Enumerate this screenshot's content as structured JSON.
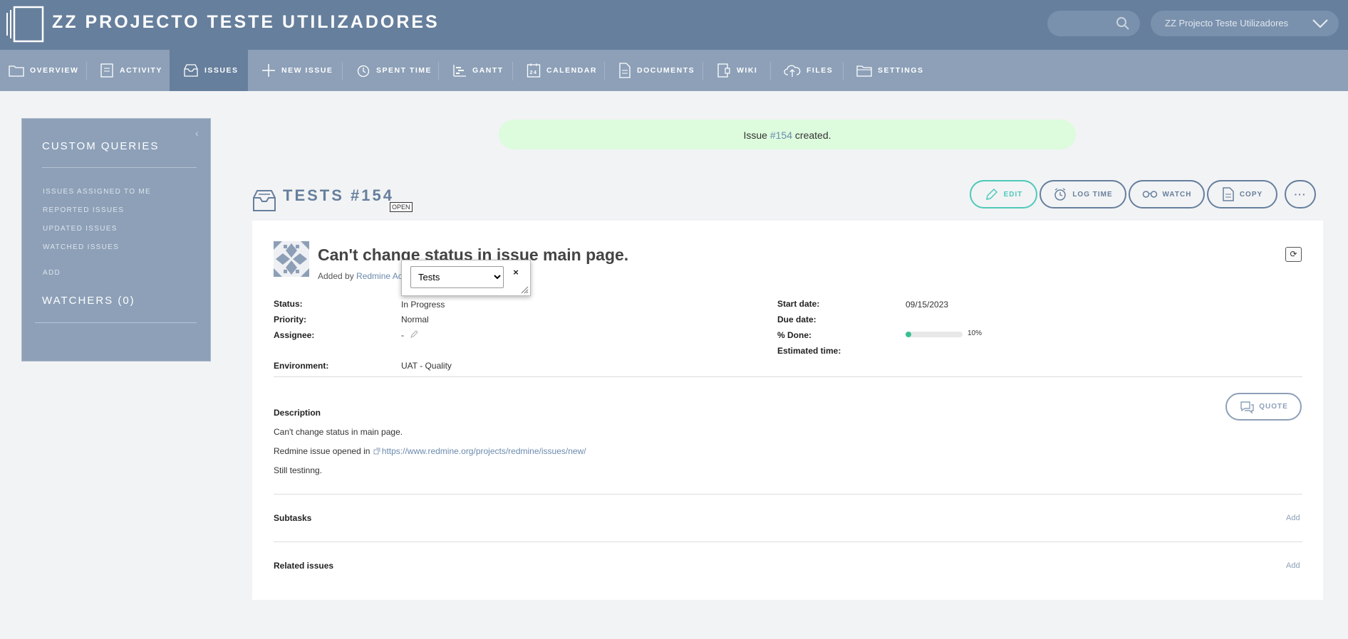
{
  "header": {
    "project_title": "ZZ PROJECTO TESTE UTILIZADORES",
    "project_jump": "ZZ Projecto Teste Utilizadores"
  },
  "menu": {
    "selected": "ISSUES",
    "tabs": [
      {
        "label": "OVERVIEW",
        "icon": "folder-icon"
      },
      {
        "label": "ACTIVITY",
        "icon": "activity-icon"
      },
      {
        "label": "ISSUES",
        "icon": "inbox-icon"
      },
      {
        "label": "NEW ISSUE",
        "icon": "plus-icon"
      },
      {
        "label": "SPENT TIME",
        "icon": "clock-icon"
      },
      {
        "label": "GANTT",
        "icon": "gantt-icon"
      },
      {
        "label": "CALENDAR",
        "icon": "calendar-icon"
      },
      {
        "label": "DOCUMENTS",
        "icon": "document-icon"
      },
      {
        "label": "WIKI",
        "icon": "wiki-icon"
      },
      {
        "label": "FILES",
        "icon": "cloud-upload-icon"
      },
      {
        "label": "SETTINGS",
        "icon": "folder-settings-icon"
      }
    ]
  },
  "sidebar": {
    "heading": "CUSTOM QUERIES",
    "links": [
      "ISSUES ASSIGNED TO ME",
      "REPORTED ISSUES",
      "UPDATED ISSUES",
      "WATCHED ISSUES"
    ],
    "add_label": "ADD",
    "watchers_heading": "WATCHERS (0)"
  },
  "flash": {
    "prefix": "Issue ",
    "issue_ref": "#154",
    "suffix": " created."
  },
  "issue": {
    "title": "TESTS #154",
    "status_badge": "OPEN",
    "subject": "Can't change status in issue main page.",
    "added_by_prefix": "Added by ",
    "author": "Redmine Ac",
    "calendar_day": "24",
    "attributes": {
      "status_label": "Status:",
      "status_value": "In Progress",
      "priority_label": "Priority:",
      "priority_value": "Normal",
      "assignee_label": "Assignee:",
      "assignee_value": "-",
      "environment_label": "Environment:",
      "environment_value": "UAT - Quality",
      "start_date_label": "Start date:",
      "start_date_value": "09/15/2023",
      "due_date_label": "Due date:",
      "due_date_value": "",
      "done_label": "% Done:",
      "done_percent": 10,
      "done_text": "10%",
      "estimated_label": "Estimated time:",
      "estimated_value": ""
    },
    "description_heading": "Description",
    "description_lines": [
      "Can't change status in main page.",
      "Redmine issue opened in ",
      "Still testinng."
    ],
    "link_url": "https://www.redmine.org/projects/redmine/issues/new/",
    "subtasks_label": "Subtasks",
    "related_label": "Related issues",
    "add_label": "Add"
  },
  "actions": {
    "edit": "EDIT",
    "log_time": "LOG TIME",
    "watch": "WATCH",
    "copy": "COPY",
    "more": "···",
    "quote": "QUOTE",
    "refresh": "⟳"
  },
  "popup": {
    "selected_tracker": "Tests",
    "close": "×"
  },
  "colors": {
    "header": "#667f9c",
    "menu": "#8da0b8",
    "accent": "#4ec9b9",
    "progress": "#37c08f",
    "flash": "#ddfbdd"
  }
}
